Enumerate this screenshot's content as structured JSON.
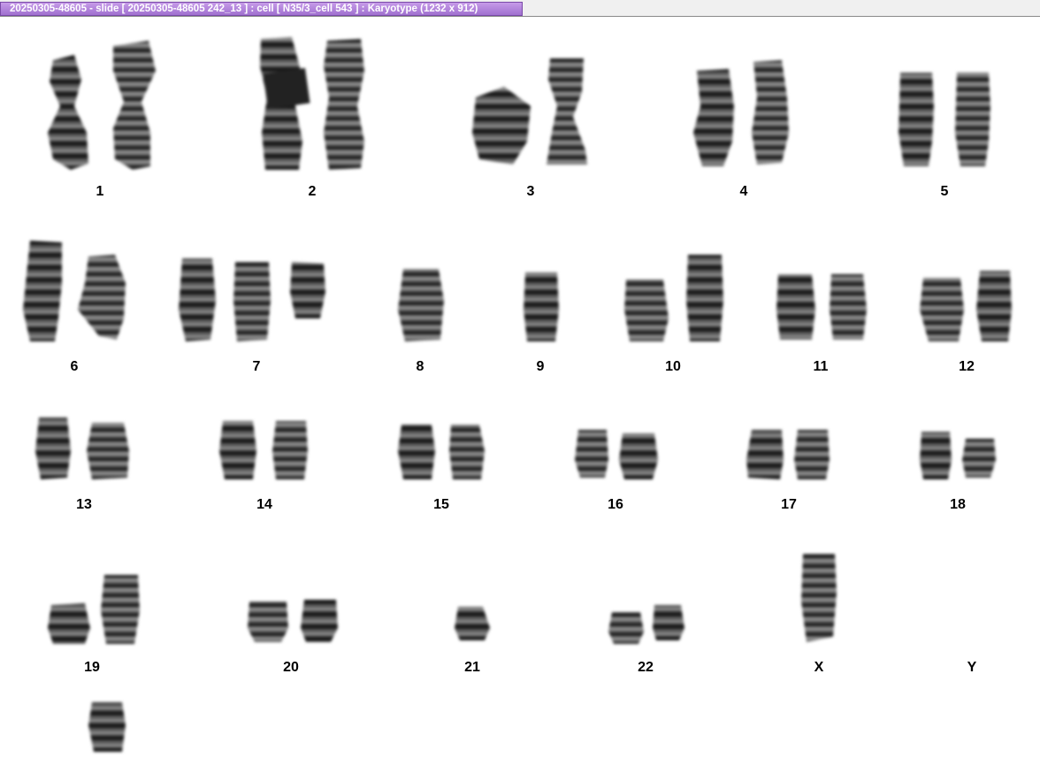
{
  "window": {
    "title": "20250305-48605 - slide [ 20250305-48605 242_13 ] : cell [ N35/3_cell 543 ] : Karyotype  (1232 x 912)"
  },
  "karyotype": {
    "labels": {
      "c1": "1",
      "c2": "2",
      "c3": "3",
      "c4": "4",
      "c5": "5",
      "c6": "6",
      "c7": "7",
      "c8": "8",
      "c9": "9",
      "c10": "10",
      "c11": "11",
      "c12": "12",
      "c13": "13",
      "c14": "14",
      "c15": "15",
      "c16": "16",
      "c17": "17",
      "c18": "18",
      "c19": "19",
      "c20": "20",
      "c21": "21",
      "c22": "22",
      "cX": "X",
      "cY": "Y"
    }
  }
}
